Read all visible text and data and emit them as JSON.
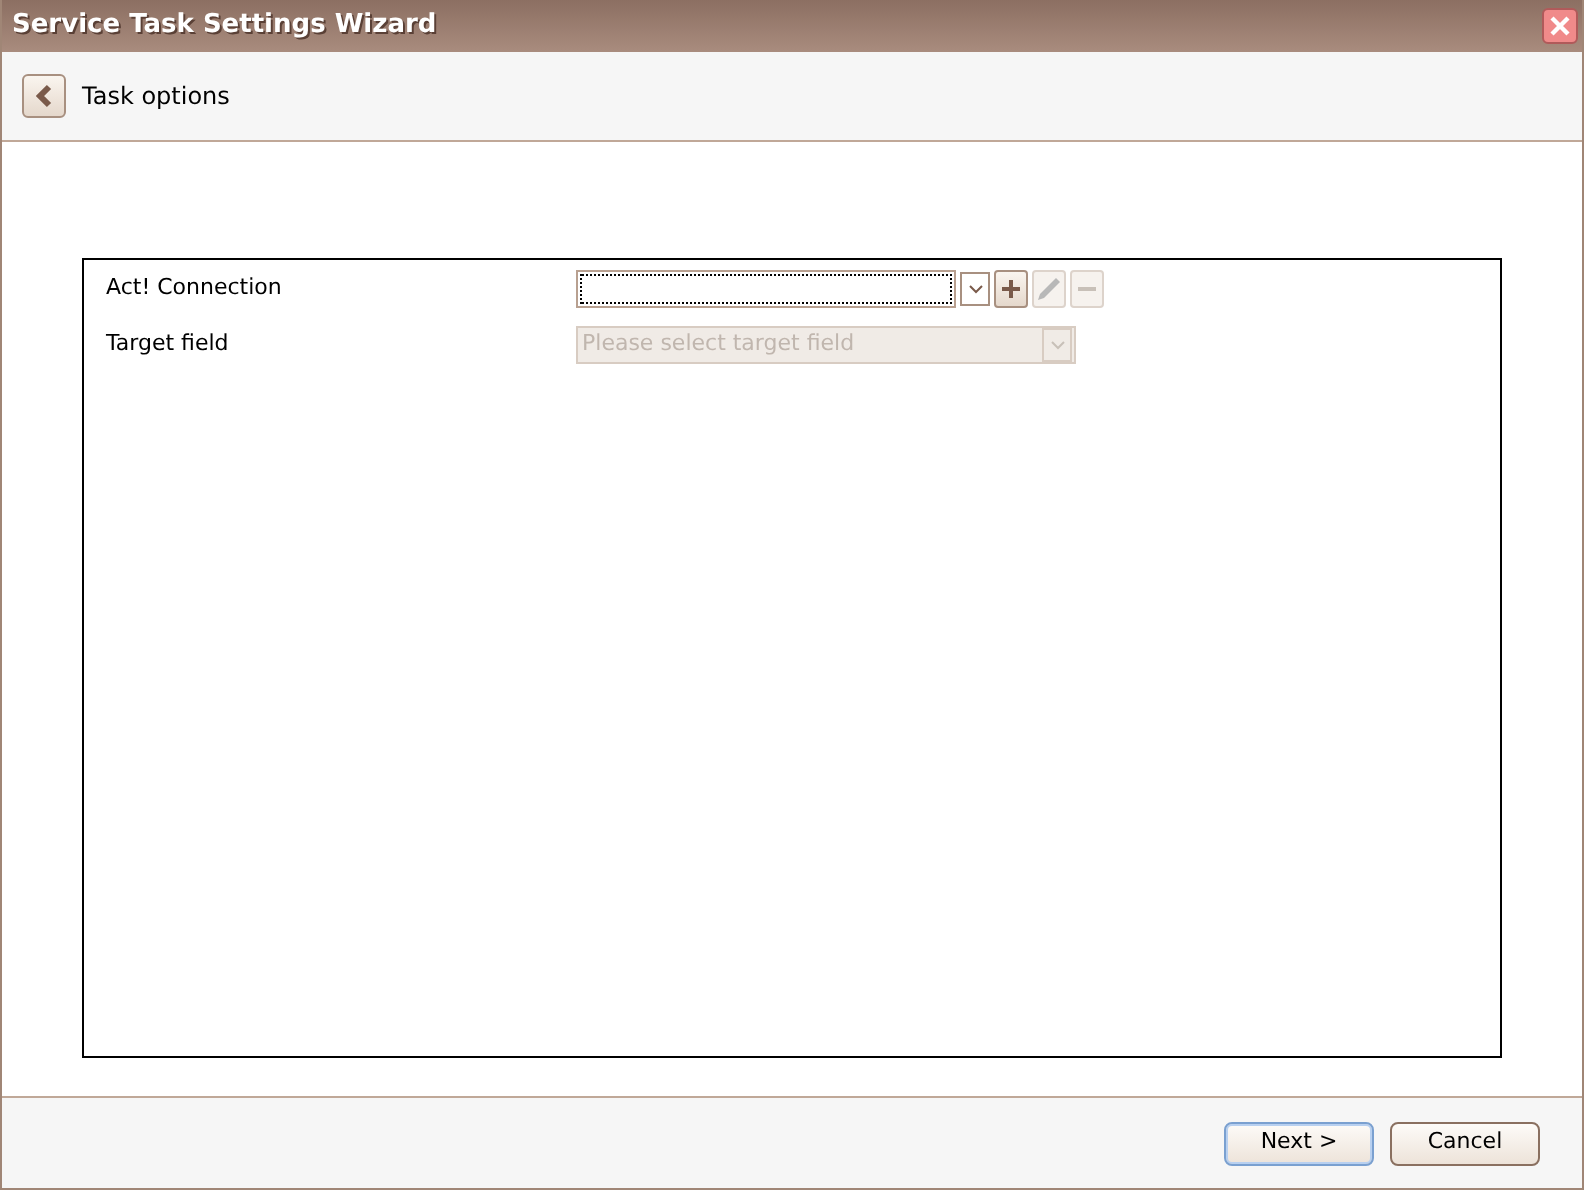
{
  "window": {
    "title": "Service Task Settings Wizard"
  },
  "header": {
    "title": "Task options"
  },
  "fields": [
    {
      "label": "Act! Connection",
      "kind": "combo-with-actions",
      "disabled": false,
      "focused": true,
      "actions": [
        {
          "kind": "add",
          "disabled": false
        },
        {
          "kind": "edit",
          "disabled": true
        },
        {
          "kind": "remove",
          "disabled": true
        }
      ]
    },
    {
      "label": "Target field",
      "kind": "combo",
      "disabled": true,
      "focused": false,
      "placeholder": "Please select target field"
    }
  ],
  "buttons": [
    {
      "label": "Next >",
      "default": true
    },
    {
      "label": "Cancel",
      "default": false
    }
  ]
}
